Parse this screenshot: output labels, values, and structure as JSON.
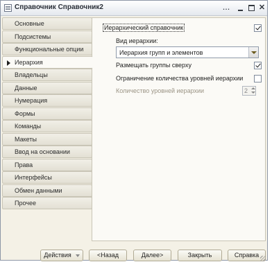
{
  "window": {
    "title": "Справочник Справочник2",
    "dots_label": "...",
    "close_label": "✕"
  },
  "nav": {
    "items": [
      {
        "label": "Основные",
        "active": false
      },
      {
        "label": "Подсистемы",
        "active": false
      },
      {
        "label": "Функциональные опции",
        "active": false
      },
      {
        "label": "Иерархия",
        "active": true
      },
      {
        "label": "Владельцы",
        "active": false
      },
      {
        "label": "Данные",
        "active": false
      },
      {
        "label": "Нумерация",
        "active": false
      },
      {
        "label": "Формы",
        "active": false
      },
      {
        "label": "Команды",
        "active": false
      },
      {
        "label": "Макеты",
        "active": false
      },
      {
        "label": "Ввод на основании",
        "active": false
      },
      {
        "label": "Права",
        "active": false
      },
      {
        "label": "Интерфейсы",
        "active": false
      },
      {
        "label": "Обмен данными",
        "active": false
      },
      {
        "label": "Прочее",
        "active": false
      }
    ]
  },
  "hierarchy": {
    "hierarchical_label": "Иерархический справочник",
    "hierarchical_checked": true,
    "type_label": "Вид иерархии:",
    "type_value": "Иерархия групп и элементов",
    "groups_on_top_label": "Размещать группы сверху",
    "groups_on_top_checked": true,
    "limit_levels_label": "Ограничение количества уровней иерархии",
    "limit_levels_checked": false,
    "levels_count_label": "Количество уровней иерархии",
    "levels_count_value": "2"
  },
  "buttons": {
    "actions": "Действия",
    "back": "<Назад",
    "next": "Далее>",
    "close": "Закрыть",
    "help": "Справка"
  }
}
